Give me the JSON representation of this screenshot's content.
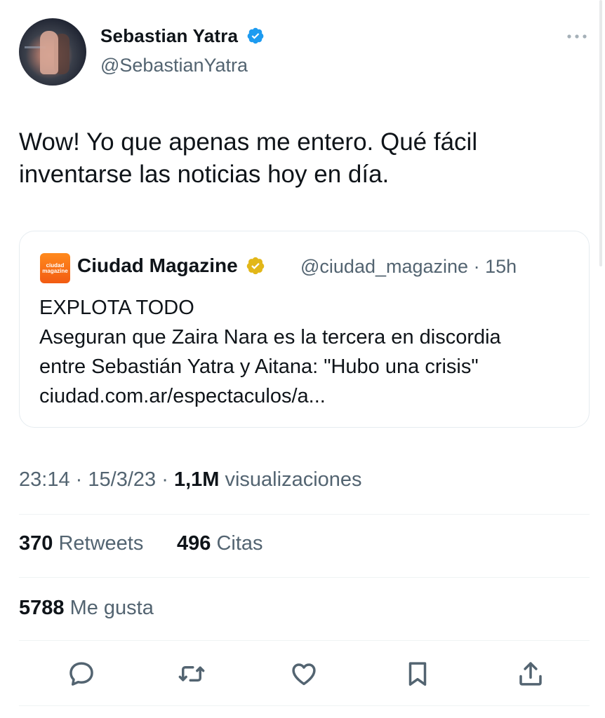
{
  "author": {
    "name": "Sebastian Yatra",
    "handle": "@SebastianYatra",
    "verified_color": "#1d9bf0"
  },
  "tweet": {
    "text_line1": "Wow! Yo que apenas me entero. Qué fácil",
    "text_line2": "inventarse las noticias hoy en día."
  },
  "quoted": {
    "logo_text_line1": "ciudad",
    "logo_text_line2": "magazine",
    "name": "Ciudad Magazine",
    "handle": "@ciudad_magazine",
    "separator": "·",
    "time": "15h",
    "verified_color": "#e2b719",
    "line1": "EXPLOTA TODO",
    "line2": "Aseguran que Zaira Nara es la tercera en discordia",
    "line3": "entre Sebastián Yatra y Aitana: \"Hubo una crisis\"",
    "line4": "ciudad.com.ar/espectaculos/a..."
  },
  "meta": {
    "time": "23:14",
    "sep1": "·",
    "date": "15/3/23",
    "sep2": "·",
    "views_count": "1,1M",
    "views_label": "visualizaciones"
  },
  "stats": {
    "retweets_count": "370",
    "retweets_label": "Retweets",
    "quotes_count": "496",
    "quotes_label": "Citas",
    "likes_count": "5788",
    "likes_label": "Me gusta"
  },
  "actions": {
    "icons": [
      "reply-icon",
      "retweet-icon",
      "like-icon",
      "bookmark-icon",
      "share-icon"
    ]
  }
}
